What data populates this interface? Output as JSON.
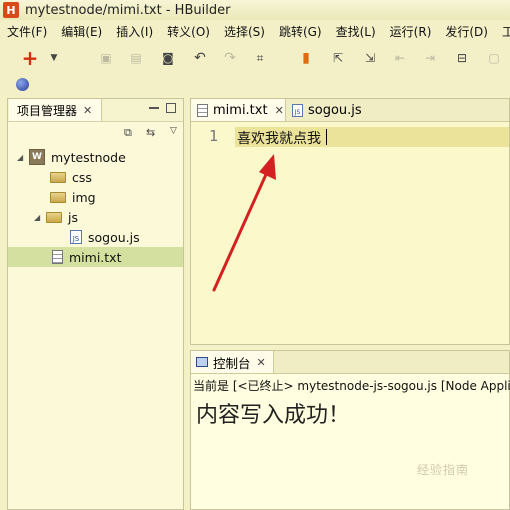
{
  "window": {
    "title": "mytestnode/mimi.txt  -  HBuilder",
    "logo": "H"
  },
  "menu": [
    "文件(F)",
    "编辑(E)",
    "插入(I)",
    "转义(O)",
    "选择(S)",
    "跳转(G)",
    "查找(L)",
    "运行(R)",
    "发行(D)",
    "工具"
  ],
  "toolbar_icons": [
    "new-file-icon",
    "dropdown-icon",
    "save-icon",
    "save-all-icon",
    "settings-icon",
    "undo-icon",
    "redo-icon",
    "format-icon",
    "bookmark-icon",
    "goto-top-icon",
    "goto-bottom-icon",
    "prev-icon",
    "next-icon",
    "export-icon",
    "window-icon"
  ],
  "project_panel": {
    "title": "项目管理器",
    "tree": [
      {
        "label": "mytestnode",
        "type": "project"
      },
      {
        "label": "css",
        "type": "folder"
      },
      {
        "label": "img",
        "type": "folder"
      },
      {
        "label": "js",
        "type": "folder"
      },
      {
        "label": "sogou.js",
        "type": "jsfile"
      },
      {
        "label": "mimi.txt",
        "type": "txtfile",
        "selected": true
      }
    ]
  },
  "editor": {
    "tabs": [
      {
        "label": "mimi.txt",
        "active": true
      },
      {
        "label": "sogou.js",
        "active": false
      }
    ],
    "line_number": "1",
    "line_text": "喜欢我就点我"
  },
  "console": {
    "tab_label": "控制台",
    "status": "当前是 [<已终止> mytestnode-js-sogou.js [Node Applic",
    "output": "内容写入成功！",
    "watermark": "经验指南"
  },
  "colors": {
    "accent_arrow": "#d42020",
    "selection": "#d3e0a0",
    "line_highlight": "#ece39a"
  }
}
